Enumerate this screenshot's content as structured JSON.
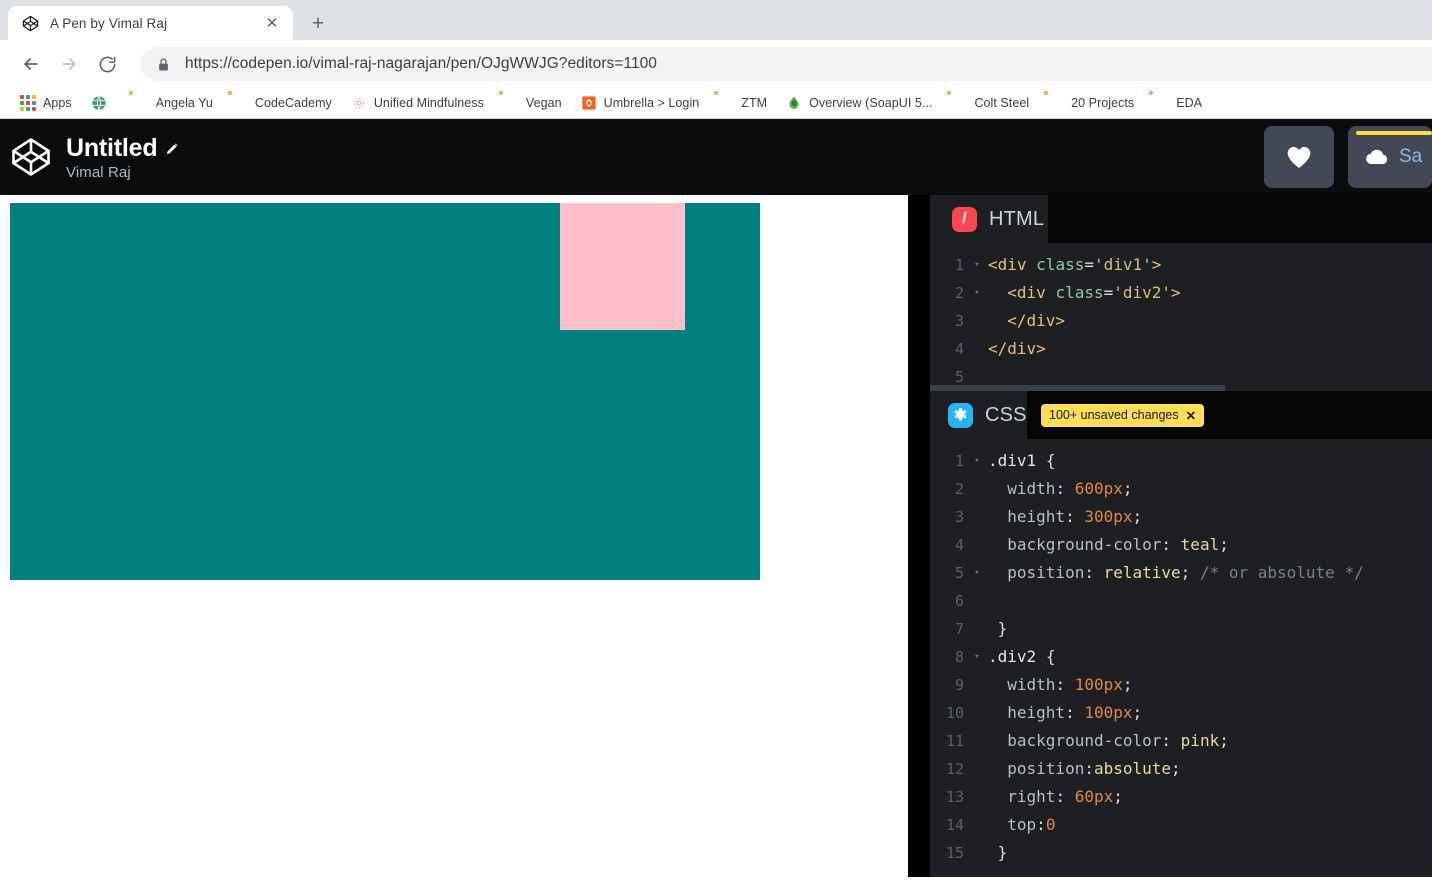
{
  "browser": {
    "tab": {
      "title": "A Pen by Vimal Raj",
      "favicon": "codepen-logo-icon",
      "close_label": "✕"
    },
    "new_tab_label": "+",
    "nav": {
      "back": "←",
      "forward": "→",
      "reload": "↻"
    },
    "omnibox": {
      "url": "https://codepen.io/vimal-raj-nagarajan/pen/OJgWWJG?editors=1100",
      "secure_icon": "lock-icon"
    },
    "bookmarks": [
      {
        "label": "Apps",
        "icon": "apps-grid-icon"
      },
      {
        "label": "",
        "icon": "globe-icon"
      },
      {
        "label": "Angela Yu",
        "icon": "folder-icon"
      },
      {
        "label": "CodeCademy",
        "icon": "folder-icon"
      },
      {
        "label": "Unified Mindfulness",
        "icon": "flower-icon"
      },
      {
        "label": "Vegan",
        "icon": "folder-icon"
      },
      {
        "label": "Umbrella > Login",
        "icon": "umbrella-orange-icon"
      },
      {
        "label": "ZTM",
        "icon": "folder-icon"
      },
      {
        "label": "Overview (SoapUI 5...",
        "icon": "soapui-green-icon"
      },
      {
        "label": "Colt Steel",
        "icon": "folder-icon"
      },
      {
        "label": "20 Projects",
        "icon": "folder-icon"
      },
      {
        "label": "EDA",
        "icon": "folder-icon"
      }
    ]
  },
  "codepen": {
    "logo_icon": "codepen-logo-icon",
    "pen_title": "Untitled",
    "edit_icon": "pencil-icon",
    "author": "Vimal Raj",
    "actions": {
      "love_icon": "heart-icon",
      "save_icon": "cloud-icon",
      "save_label": "Sa"
    },
    "accent_yellow": "#ffdd40",
    "button_bg": "#434857"
  },
  "preview": {
    "div1_color": "#008080",
    "div2_color": "#ffc0cb"
  },
  "editors": {
    "html": {
      "tab_label": "HTML",
      "badge_glyph": "/",
      "badge_color": "#fb4550",
      "lines": [
        {
          "num": "1",
          "fold": "▾"
        },
        {
          "num": "2",
          "fold": "▾"
        },
        {
          "num": "3",
          "fold": ""
        },
        {
          "num": "4",
          "fold": ""
        },
        {
          "num": "5",
          "fold": ""
        }
      ],
      "code": [
        "<div class='div1'>",
        "  <div class='div2'>",
        "  </div>",
        "</div>",
        ""
      ]
    },
    "css": {
      "tab_label": "CSS",
      "badge_glyph": "✱",
      "badge_color": "#26b4f5",
      "unsaved_badge": "100+ unsaved changes",
      "unsaved_close": "✕",
      "lines": [
        {
          "num": "1",
          "fold": "▾"
        },
        {
          "num": "2",
          "fold": ""
        },
        {
          "num": "3",
          "fold": ""
        },
        {
          "num": "4",
          "fold": ""
        },
        {
          "num": "5",
          "fold": "▾"
        },
        {
          "num": "6",
          "fold": ""
        },
        {
          "num": "7",
          "fold": ""
        },
        {
          "num": "8",
          "fold": "▾"
        },
        {
          "num": "9",
          "fold": ""
        },
        {
          "num": "10",
          "fold": ""
        },
        {
          "num": "11",
          "fold": ""
        },
        {
          "num": "12",
          "fold": ""
        },
        {
          "num": "13",
          "fold": ""
        },
        {
          "num": "14",
          "fold": ""
        },
        {
          "num": "15",
          "fold": ""
        }
      ],
      "code": [
        ".div1 {",
        "  width: 600px;",
        "  height: 300px;",
        "  background-color: teal;",
        "  position: relative; /* or absolute */",
        "",
        " }",
        ".div2 {",
        "  width: 100px;",
        "  height: 100px;",
        "  background-color: pink;",
        "  position:absolute;",
        "  right: 60px;",
        "  top:0",
        " }"
      ]
    }
  }
}
